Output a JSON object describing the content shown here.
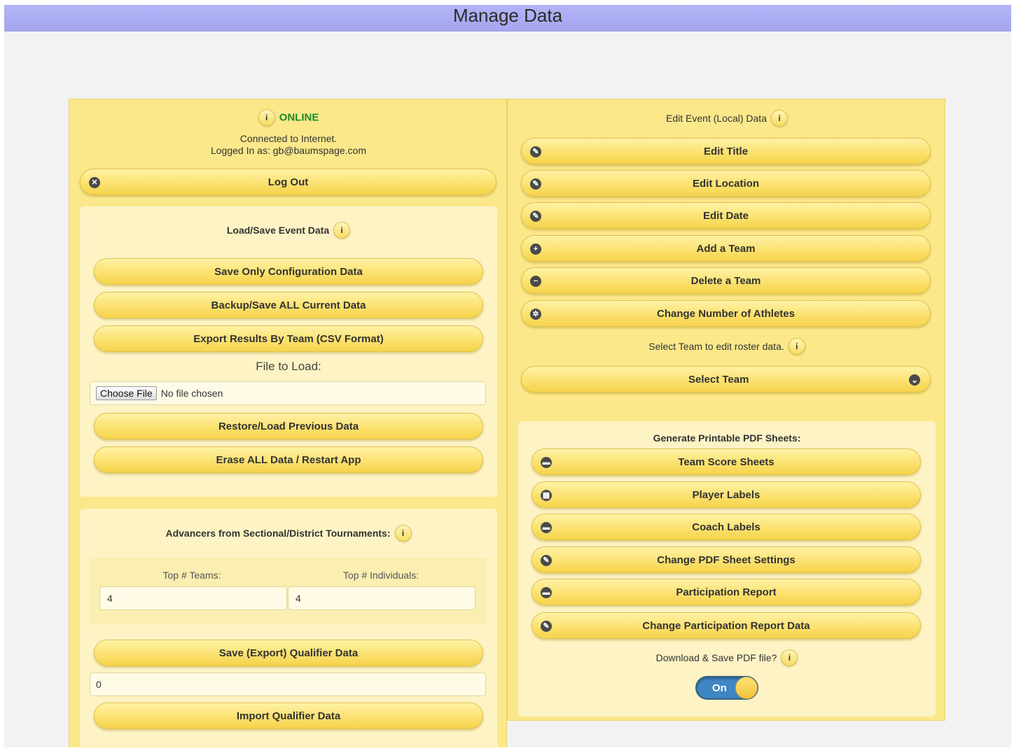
{
  "header": {
    "title": "Manage Data"
  },
  "left": {
    "status": {
      "label": "ONLINE",
      "line1": "Connected to Internet.",
      "line2": "Logged In as: gb@baumspage.com"
    },
    "logout_label": "Log Out",
    "loadsave": {
      "title": "Load/Save Event Data",
      "save_config": "Save Only Configuration Data",
      "backup_all": "Backup/Save ALL Current Data",
      "export_csv": "Export Results By Team (CSV Format)",
      "file_label": "File to Load:",
      "choose_file": "Choose File",
      "no_file": "No file chosen",
      "restore": "Restore/Load Previous Data",
      "erase": "Erase ALL Data / Restart App"
    },
    "advancers": {
      "title": "Advancers from Sectional/District Tournaments:",
      "teams_label": "Top # Teams:",
      "individuals_label": "Top # Individuals:",
      "teams_value": "4",
      "individuals_value": "4",
      "save_qualifier": "Save (Export) Qualifier Data",
      "qualifier_value": "0",
      "import_qualifier": "Import Qualifier Data"
    }
  },
  "right": {
    "edit_title": "Edit Event (Local) Data",
    "buttons": {
      "edit_title": "Edit Title",
      "edit_location": "Edit Location",
      "edit_date": "Edit Date",
      "add_team": "Add a Team",
      "delete_team": "Delete a Team",
      "change_athletes": "Change Number of Athletes"
    },
    "select_team_prompt": "Select Team to edit roster data.",
    "select_team": "Select Team",
    "pdf": {
      "title": "Generate Printable PDF Sheets:",
      "team_score": "Team Score Sheets",
      "player_labels": "Player Labels",
      "coach_labels": "Coach Labels",
      "pdf_settings": "Change PDF Sheet Settings",
      "participation": "Participation Report",
      "participation_data": "Change Participation Report Data",
      "download_prompt": "Download & Save PDF file?",
      "toggle_label": "On"
    }
  },
  "info_glyph": "i",
  "icons": {
    "close": "✕",
    "edit": "✎",
    "plus": "+",
    "minus": "−",
    "gear": "✲",
    "chevron": "⌄",
    "doc": "▬",
    "grid": "▦"
  }
}
